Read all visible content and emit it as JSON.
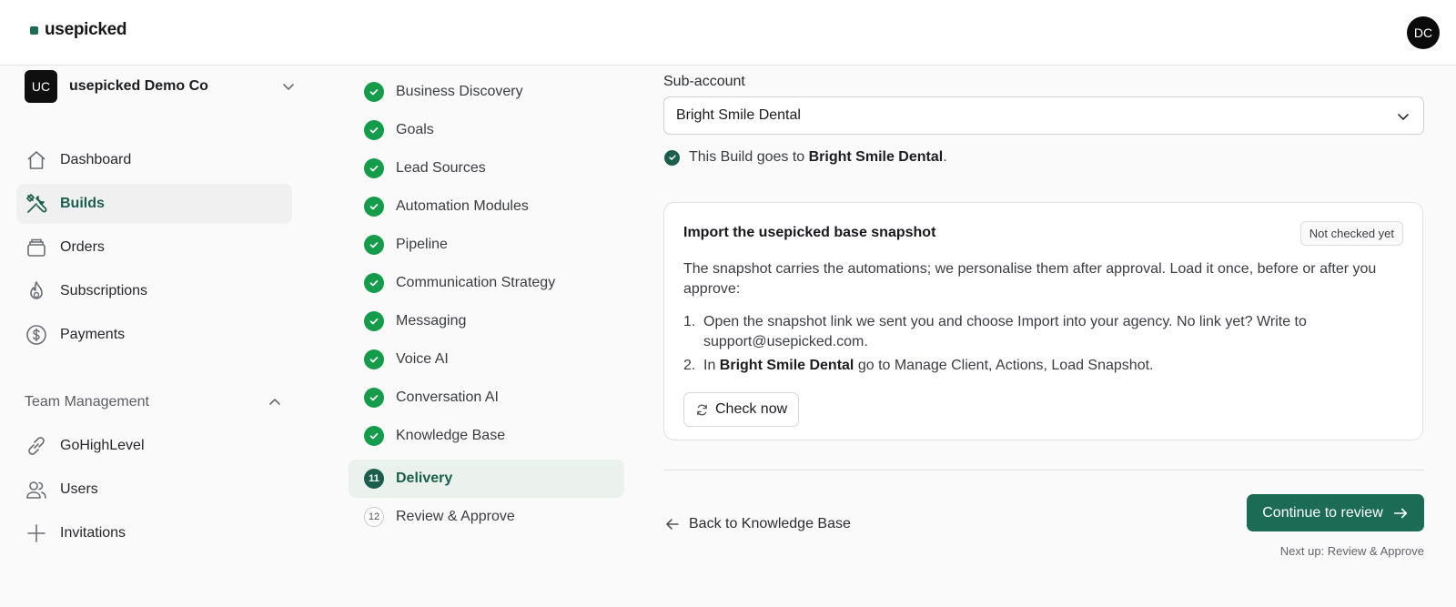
{
  "brand": {
    "name": "usepicked",
    "accent": "#1b6b55"
  },
  "user": {
    "initials": "DC"
  },
  "org": {
    "initials": "UC",
    "name": "usepicked Demo Co"
  },
  "nav": [
    {
      "label": "Dashboard",
      "icon": "home-icon"
    },
    {
      "label": "Builds",
      "icon": "tools-icon",
      "active": true
    },
    {
      "label": "Orders",
      "icon": "orders-icon"
    },
    {
      "label": "Subscriptions",
      "icon": "flame-icon"
    },
    {
      "label": "Payments",
      "icon": "dollar-icon"
    }
  ],
  "team": {
    "title": "Team Management",
    "items": [
      {
        "label": "GoHighLevel",
        "icon": "link-icon"
      },
      {
        "label": "Users",
        "icon": "users-icon"
      },
      {
        "label": "Invitations",
        "icon": "plus-icon"
      }
    ]
  },
  "steps": [
    {
      "label": "Business Discovery",
      "status": "done"
    },
    {
      "label": "Goals",
      "status": "done"
    },
    {
      "label": "Lead Sources",
      "status": "done"
    },
    {
      "label": "Automation Modules",
      "status": "done"
    },
    {
      "label": "Pipeline",
      "status": "done"
    },
    {
      "label": "Communication Strategy",
      "status": "done"
    },
    {
      "label": "Messaging",
      "status": "done"
    },
    {
      "label": "Voice AI",
      "status": "done"
    },
    {
      "label": "Conversation AI",
      "status": "done"
    },
    {
      "label": "Knowledge Base",
      "status": "done"
    },
    {
      "label": "Delivery",
      "status": "current",
      "number": "11"
    },
    {
      "label": "Review & Approve",
      "status": "todo",
      "number": "12"
    }
  ],
  "main": {
    "subaccount_label": "Sub-account",
    "subaccount_value": "Bright Smile Dental",
    "confirm_prefix": "This Build goes to ",
    "confirm_name": "Bright Smile Dental",
    "confirm_suffix": ".",
    "card": {
      "title": "Import the usepicked base snapshot",
      "badge": "Not checked yet",
      "desc": "The snapshot carries the automations; we personalise them after approval. Load it once, before or after you approve:",
      "step1_num": "1.",
      "step1": "Open the snapshot link we sent you and choose Import into your agency. No link yet? Write to support@usepicked.com.",
      "step2_num": "2.",
      "step2_prefix": "In ",
      "step2_name": "Bright Smile Dental",
      "step2_suffix": " go to Manage Client, Actions, Load Snapshot.",
      "check_label": "Check now"
    },
    "back_label": "Back to Knowledge Base",
    "continue_label": "Continue to review",
    "next_up": "Next up: Review & Approve"
  }
}
